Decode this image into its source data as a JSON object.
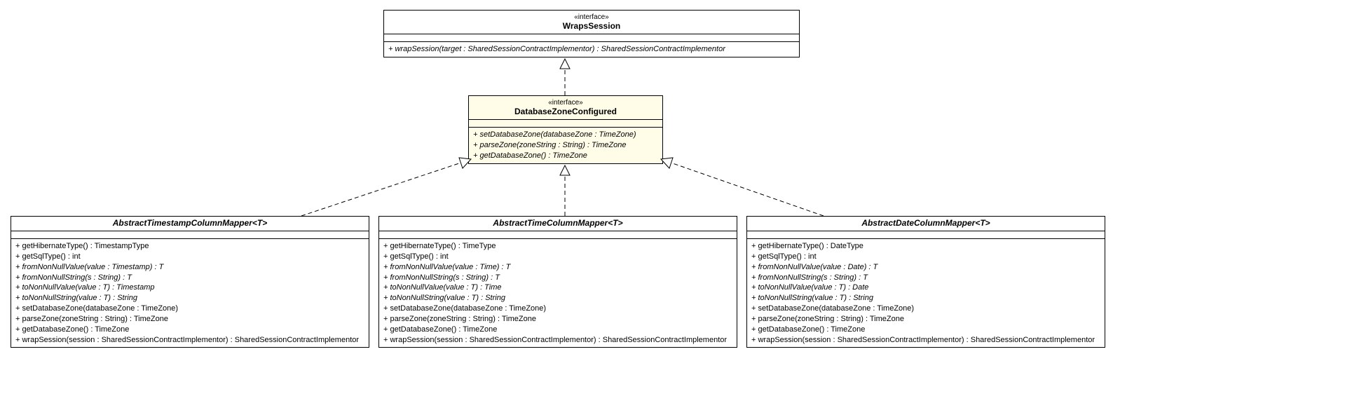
{
  "interfaces": {
    "wraps_session": {
      "stereotype": "«interface»",
      "name": "WrapsSession",
      "methods": {
        "m0": "+ wrapSession(target : SharedSessionContractImplementor) : SharedSessionContractImplementor"
      }
    },
    "db_zone_configured": {
      "stereotype": "«interface»",
      "name": "DatabaseZoneConfigured",
      "methods": {
        "m0": "+ setDatabaseZone(databaseZone : TimeZone)",
        "m1": "+ parseZone(zoneString : String) : TimeZone",
        "m2": "+ getDatabaseZone() : TimeZone"
      }
    }
  },
  "classes": {
    "timestamp_mapper": {
      "name": "AbstractTimestampColumnMapper<T>",
      "methods": {
        "m0": "+ getHibernateType() : TimestampType",
        "m1": "+ getSqlType() : int",
        "m2": "+ fromNonNullValue(value : Timestamp) : T",
        "m3": "+ fromNonNullString(s : String) : T",
        "m4": "+ toNonNullValue(value : T) : Timestamp",
        "m5": "+ toNonNullString(value : T) : String",
        "m6": "+ setDatabaseZone(databaseZone : TimeZone)",
        "m7": "+ parseZone(zoneString : String) : TimeZone",
        "m8": "+ getDatabaseZone() : TimeZone",
        "m9": "+ wrapSession(session : SharedSessionContractImplementor) : SharedSessionContractImplementor"
      }
    },
    "time_mapper": {
      "name": "AbstractTimeColumnMapper<T>",
      "methods": {
        "m0": "+ getHibernateType() : TimeType",
        "m1": "+ getSqlType() : int",
        "m2": "+ fromNonNullValue(value : Time) : T",
        "m3": "+ fromNonNullString(s : String) : T",
        "m4": "+ toNonNullValue(value : T) : Time",
        "m5": "+ toNonNullString(value : T) : String",
        "m6": "+ setDatabaseZone(databaseZone : TimeZone)",
        "m7": "+ parseZone(zoneString : String) : TimeZone",
        "m8": "+ getDatabaseZone() : TimeZone",
        "m9": "+ wrapSession(session : SharedSessionContractImplementor) : SharedSessionContractImplementor"
      }
    },
    "date_mapper": {
      "name": "AbstractDateColumnMapper<T>",
      "methods": {
        "m0": "+ getHibernateType() : DateType",
        "m1": "+ getSqlType() : int",
        "m2": "+ fromNonNullValue(value : Date) : T",
        "m3": "+ fromNonNullString(s : String) : T",
        "m4": "+ toNonNullValue(value : T) : Date",
        "m5": "+ toNonNullString(value : T) : String",
        "m6": "+ setDatabaseZone(databaseZone : TimeZone)",
        "m7": "+ parseZone(zoneString : String) : TimeZone",
        "m8": "+ getDatabaseZone() : TimeZone",
        "m9": "+ wrapSession(session : SharedSessionContractImplementor) : SharedSessionContractImplementor"
      }
    }
  }
}
